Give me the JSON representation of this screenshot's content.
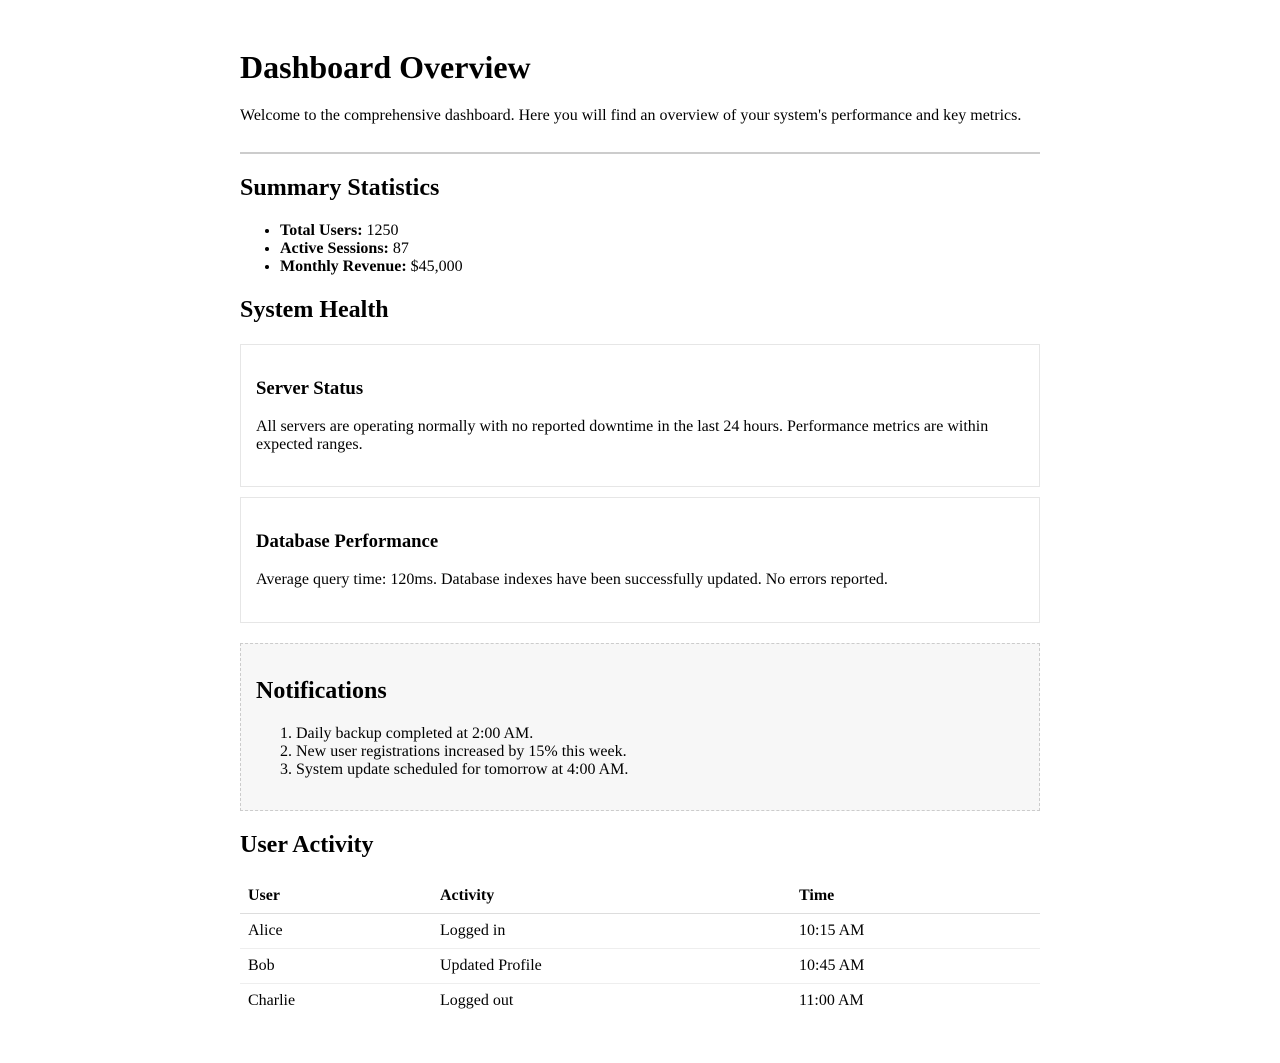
{
  "header": {
    "title": "Dashboard Overview",
    "intro": "Welcome to the comprehensive dashboard. Here you will find an overview of your system's performance and key metrics."
  },
  "summary": {
    "heading": "Summary Statistics",
    "items": [
      {
        "label": "Total Users:",
        "value": "1250"
      },
      {
        "label": "Active Sessions:",
        "value": "87"
      },
      {
        "label": "Monthly Revenue:",
        "value": "$45,000"
      }
    ]
  },
  "health": {
    "heading": "System Health",
    "cards": [
      {
        "title": "Server Status",
        "text": "All servers are operating normally with no reported downtime in the last 24 hours. Performance metrics are within expected ranges."
      },
      {
        "title": "Database Performance",
        "text": "Average query time: 120ms. Database indexes have been successfully updated. No errors reported."
      }
    ]
  },
  "notifications": {
    "heading": "Notifications",
    "items": [
      "Daily backup completed at 2:00 AM.",
      "New user registrations increased by 15% this week.",
      "System update scheduled for tomorrow at 4:00 AM."
    ]
  },
  "activity": {
    "heading": "User Activity",
    "columns": [
      "User",
      "Activity",
      "Time"
    ],
    "rows": [
      [
        "Alice",
        "Logged in",
        "10:15 AM"
      ],
      [
        "Bob",
        "Updated Profile",
        "10:45 AM"
      ],
      [
        "Charlie",
        "Logged out",
        "11:00 AM"
      ]
    ]
  },
  "colors": {
    "background": "#ffffff",
    "text": "#000000",
    "divider": "#cccccc",
    "notifications_bg": "#f7f7f7"
  }
}
